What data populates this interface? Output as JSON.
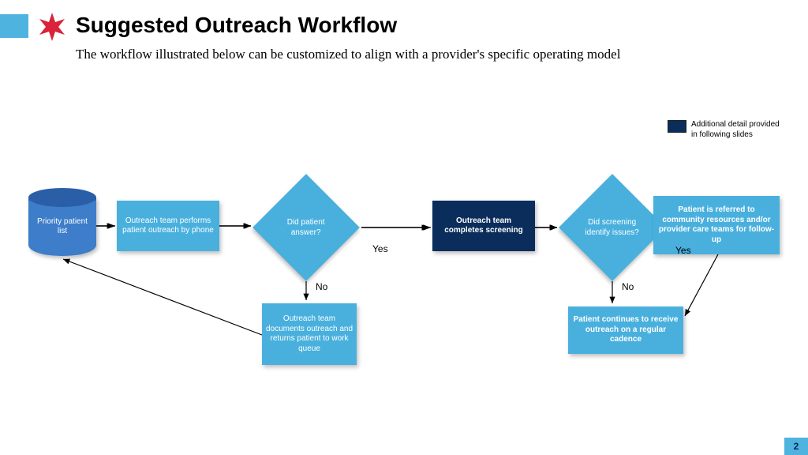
{
  "header": {
    "title": "Suggested Outreach Workflow",
    "subtitle": "The workflow illustrated below can be customized to align with a provider's specific operating model"
  },
  "legend": {
    "text": "Additional detail provided in following slides"
  },
  "nodes": {
    "start": "Priority patient list",
    "outreach": "Outreach team performs patient outreach by phone",
    "q_answer": "Did patient answer?",
    "screening": "Outreach team completes screening",
    "q_issues": "Did screening identify issues?",
    "referred": "Patient is referred to community resources and/or provider care teams for follow-up",
    "document": "Outreach team documents outreach and returns patient to work queue",
    "cadence": "Patient continues to receive outreach on a regular cadence"
  },
  "labels": {
    "yes": "Yes",
    "no": "No"
  },
  "page": "2",
  "colors": {
    "light": "#49b0de",
    "dark": "#0a2d5c",
    "accent": "#4fb3e0",
    "star": "#d8233a"
  }
}
